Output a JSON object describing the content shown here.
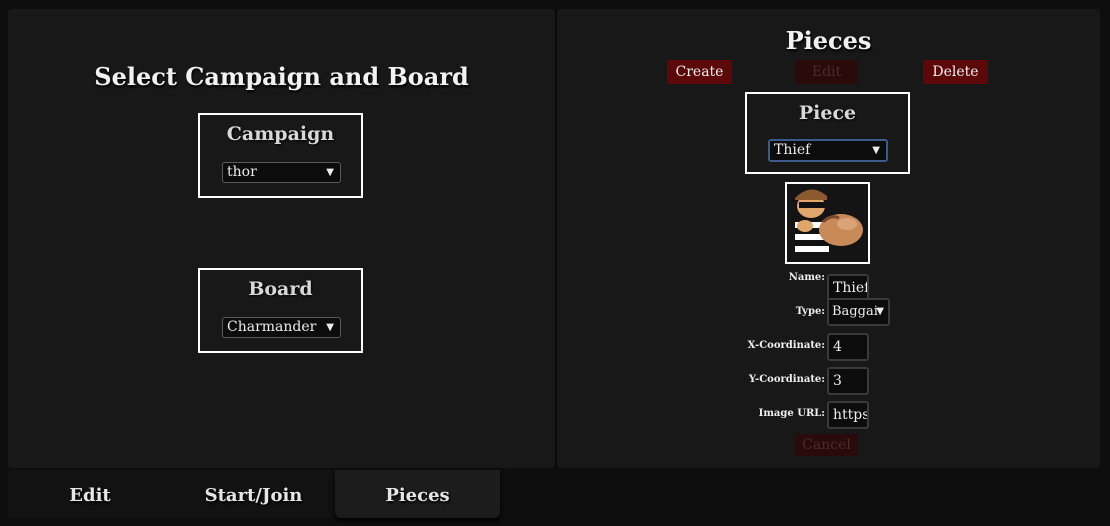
{
  "left_panel": {
    "title": "Select Campaign and Board",
    "campaign": {
      "label": "Campaign",
      "selected": "thor"
    },
    "board": {
      "label": "Board",
      "selected": "Charmander"
    }
  },
  "right_panel": {
    "title": "Pieces",
    "buttons": {
      "create": "Create",
      "edit": "Edit",
      "delete": "Delete",
      "cancel": "Cancel"
    },
    "piece_select": {
      "label": "Piece",
      "selected": "Thief"
    },
    "fields": {
      "name_label": "Name:",
      "name_value": "Thief",
      "type_label": "Type:",
      "type_value": "Baggai",
      "x_label": "X-Coordinate:",
      "x_value": "4",
      "y_label": "Y-Coordinate:",
      "y_value": "3",
      "url_label": "Image URL:",
      "url_value": "https:"
    }
  },
  "tabs": [
    {
      "label": "Edit",
      "active": false
    },
    {
      "label": "Start/Join",
      "active": false
    },
    {
      "label": "Pieces",
      "active": true
    }
  ],
  "colors": {
    "button_active": "#5c0808",
    "button_disabled": "#2a0a0a",
    "panel": "#181818"
  }
}
